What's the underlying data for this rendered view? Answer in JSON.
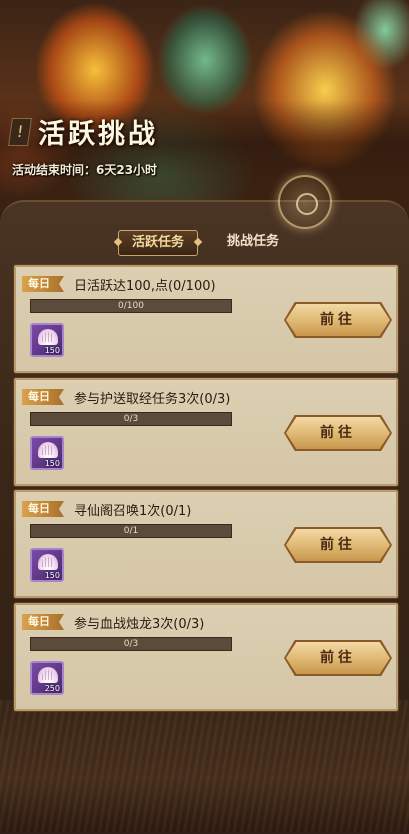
{
  "header": {
    "title": "活跃挑战",
    "end_time": "活动结束时间：6天23小时",
    "alert_glyph": "!"
  },
  "tabs": [
    {
      "label": "活跃任务",
      "active": true
    },
    {
      "label": "挑战任务",
      "active": false
    }
  ],
  "tasks": [
    {
      "badge": "每日",
      "name": "日活跃达100,点(0/100)",
      "progress_text": "0/100",
      "progress": 0,
      "reward_icon": "shell-icon",
      "reward_qty": "150",
      "button": "前往"
    },
    {
      "badge": "每日",
      "name": "参与护送取经任务3次(0/3)",
      "progress_text": "0/3",
      "progress": 0,
      "reward_icon": "shell-icon",
      "reward_qty": "150",
      "button": "前往"
    },
    {
      "badge": "每日",
      "name": "寻仙阁召唤1次(0/1)",
      "progress_text": "0/1",
      "progress": 0,
      "reward_icon": "shell-icon",
      "reward_qty": "150",
      "button": "前往"
    },
    {
      "badge": "每日",
      "name": "参与血战烛龙3次(0/3)",
      "progress_text": "0/3",
      "progress": 0,
      "reward_icon": "shell-icon",
      "reward_qty": "250",
      "button": "前往"
    }
  ],
  "colors": {
    "accent": "#e0ba76",
    "card_bg": "#d4c6a6",
    "badge": "#d9a24c"
  }
}
